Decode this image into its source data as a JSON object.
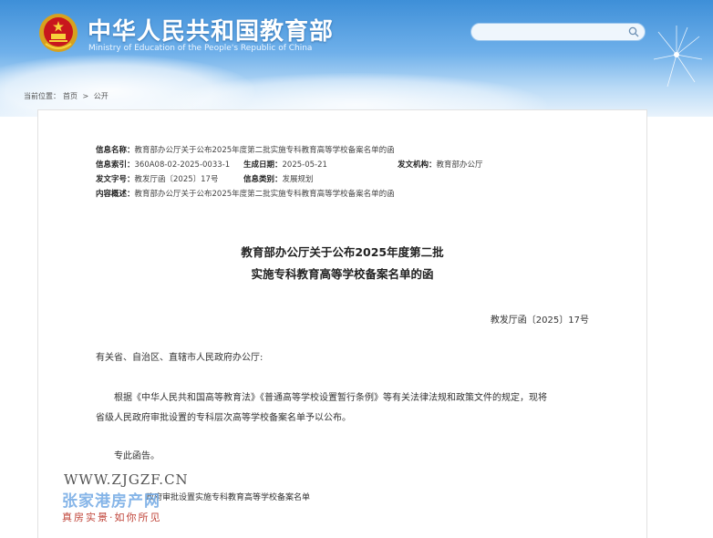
{
  "header": {
    "site_title": "中华人民共和国教育部",
    "site_subtitle": "Ministry of Education of the People's Republic of China",
    "search_placeholder": ""
  },
  "breadcrumb": {
    "label": "当前位置：",
    "home": "首页",
    "separator": ">",
    "current": "公开"
  },
  "meta": {
    "name_label": "信息名称：",
    "name_value": "教育部办公厅关于公布2025年度第二批实施专科教育高等学校备案名单的函",
    "index_label": "信息索引：",
    "index_value": "360A08-02-2025-0033-1",
    "date_label": "生成日期：",
    "date_value": "2025-05-21",
    "org_label": "发文机构：",
    "org_value": "教育部办公厅",
    "code_label": "发文字号：",
    "code_value": "教发厅函〔2025〕17号",
    "category_label": "信息类别：",
    "category_value": "发展规划",
    "summary_label": "内容概述：",
    "summary_value": "教育部办公厅关于公布2025年度第二批实施专科教育高等学校备案名单的函"
  },
  "document": {
    "title_line1": "教育部办公厅关于公布2025年度第二批",
    "title_line2": "实施专科教育高等学校备案名单的函",
    "number": "教发厅函〔2025〕17号",
    "salutation": "有关省、自治区、直辖市人民政府办公厅:",
    "body_line1": "根据《中华人民共和国高等教育法》《普通高等学校设置暂行条例》等有关法律法规和政策文件的规定，现将",
    "body_line2": "省级人民政府审批设置的专科层次高等学校备案名单予以公布。",
    "closing": "专此函告。",
    "attachment": "政府审批设置实施专科教育高等学校备案名单"
  },
  "watermark": {
    "url": "WWW.ZJGZF.CN",
    "name": "张家港房产网",
    "slogan": "真房实景·如你所见"
  }
}
